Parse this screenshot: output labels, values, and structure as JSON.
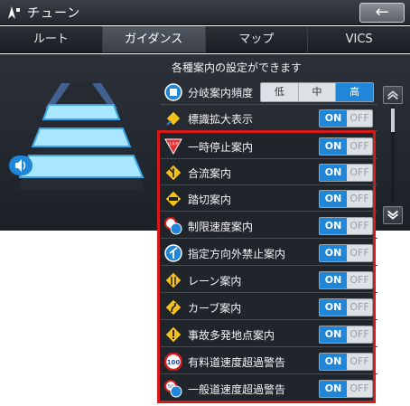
{
  "title": "チューン",
  "back_label": "←",
  "tabs": [
    "ルート",
    "ガイダンス",
    "マップ",
    "VICS"
  ],
  "active_tab": 1,
  "header": "各種案内の設定ができます",
  "branch_row": {
    "label": "分岐案内頻度",
    "options": [
      "低",
      "中",
      "高"
    ],
    "selected": 2
  },
  "sign_row": {
    "label": "標識拡大表示",
    "on": "ON",
    "off": "OFF"
  },
  "highlighted_rows": [
    {
      "label": "一時停止案内",
      "on": "ON",
      "off": "OFF",
      "icon": "stop-sign-icon"
    },
    {
      "label": "合流案内",
      "on": "ON",
      "off": "OFF",
      "icon": "merge-sign-icon"
    },
    {
      "label": "踏切案内",
      "on": "ON",
      "off": "OFF",
      "icon": "railroad-crossing-icon"
    },
    {
      "label": "制限速度案内",
      "on": "ON",
      "off": "OFF",
      "icon": "speed-limit-icon"
    },
    {
      "label": "指定方向外禁止案内",
      "on": "ON",
      "off": "OFF",
      "icon": "direction-sign-icon"
    },
    {
      "label": "レーン案内",
      "on": "ON",
      "off": "OFF",
      "icon": "lane-sign-icon"
    },
    {
      "label": "カーブ案内",
      "on": "ON",
      "off": "OFF",
      "icon": "curve-sign-icon"
    },
    {
      "label": "事故多発地点案内",
      "on": "ON",
      "off": "OFF",
      "icon": "warning-sign-icon"
    },
    {
      "label": "有料道速度超過警告",
      "on": "ON",
      "off": "OFF",
      "icon": "speed-100-icon"
    },
    {
      "label": "一般道速度超過警告",
      "on": "ON",
      "off": "OFF",
      "icon": "speed-50-icon"
    }
  ],
  "stop_sign_text": "止まれ",
  "speed_100_text": "100",
  "speed_50_text": "50",
  "colors": {
    "accent": "#1f86d8",
    "highlight": "#d61a1a"
  }
}
